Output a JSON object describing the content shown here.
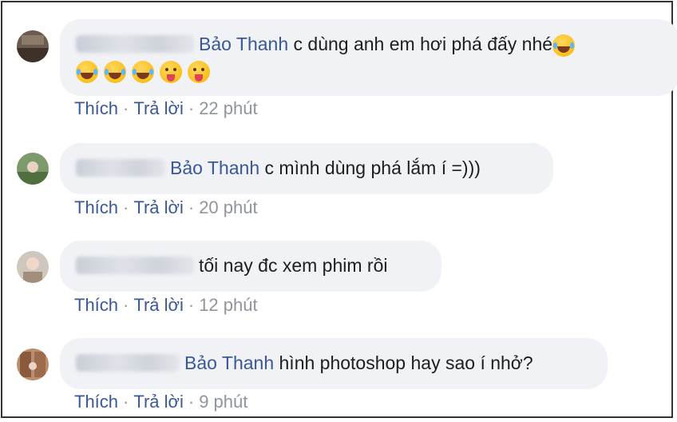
{
  "comments": [
    {
      "mention": "Bảo Thanh",
      "text": "c dùng anh em hơi phá đấy nhé",
      "emoji_inline": "laugh-cry-emoji",
      "emoji_row": [
        "laugh-cry-emoji",
        "laugh-cry-emoji",
        "laugh-cry-emoji",
        "tongue-wink-emoji",
        "tongue-wink-emoji"
      ],
      "like_label": "Thích",
      "reply_label": "Trả lời",
      "time": "22 phút"
    },
    {
      "mention": "Bảo Thanh",
      "text": "c mình dùng phá lắm í =)))",
      "like_label": "Thích",
      "reply_label": "Trả lời",
      "time": "20 phút"
    },
    {
      "text": "tối nay đc xem phim rồi",
      "like_label": "Thích",
      "reply_label": "Trả lời",
      "time": "12 phút"
    },
    {
      "mention": "Bảo Thanh",
      "text": "hình photoshop hay sao í nhở?",
      "like_label": "Thích",
      "reply_label": "Trả lời",
      "time": "9 phút"
    }
  ],
  "separator": "·",
  "colors": {
    "link": "#385898",
    "bubble": "#f0f2f5",
    "meta": "#90949c"
  }
}
